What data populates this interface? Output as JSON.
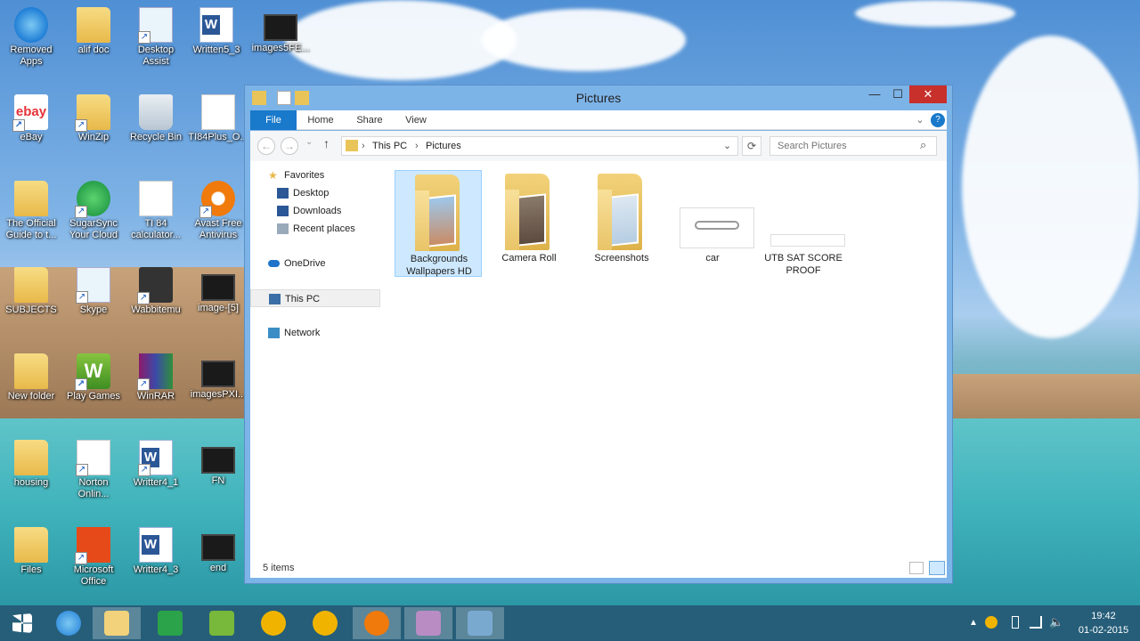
{
  "desktop": {
    "icons": [
      {
        "label": "Removed Apps"
      },
      {
        "label": "alif doc"
      },
      {
        "label": "Desktop Assist"
      },
      {
        "label": "Written5_3"
      },
      {
        "label": "images5FE..."
      },
      {
        "label": "eBay"
      },
      {
        "label": "WinZip"
      },
      {
        "label": "Recycle Bin"
      },
      {
        "label": "TI84Plus_O..."
      },
      {
        "label": "The Official Guide to t..."
      },
      {
        "label": "SugarSync Your Cloud"
      },
      {
        "label": "TI 84 calculator..."
      },
      {
        "label": "Avast Free Antivirus"
      },
      {
        "label": "SUBJECTS"
      },
      {
        "label": "Skype"
      },
      {
        "label": "Wabbitemu"
      },
      {
        "label": "image-[5]"
      },
      {
        "label": "New folder"
      },
      {
        "label": "Play Games"
      },
      {
        "label": "WinRAR"
      },
      {
        "label": "imagesPXI..."
      },
      {
        "label": "housing"
      },
      {
        "label": "Norton Onlin..."
      },
      {
        "label": "Writter4_1"
      },
      {
        "label": "FN"
      },
      {
        "label": "Files"
      },
      {
        "label": "Microsoft Office"
      },
      {
        "label": "Writter4_3"
      },
      {
        "label": "end"
      }
    ],
    "ebay_text": "ebay",
    "games_text": "W"
  },
  "window": {
    "title": "Pictures",
    "controls": {
      "minimize": "—",
      "maximize": "☐",
      "close": "✕"
    },
    "ribbon": {
      "file": "File",
      "home": "Home",
      "share": "Share",
      "view": "View",
      "help": "?"
    },
    "nav": {
      "back": "←",
      "forward": "→",
      "up": "↑",
      "refresh": "⟳",
      "dropdown": "⌄"
    },
    "address": {
      "crumb1": "This PC",
      "crumb2": "Pictures",
      "sep": "›"
    },
    "search": {
      "placeholder": "Search Pictures",
      "icon": "⌕"
    },
    "navpane": {
      "favorites": "Favorites",
      "desktop": "Desktop",
      "downloads": "Downloads",
      "recent": "Recent places",
      "onedrive": "OneDrive",
      "thispc": "This PC",
      "network": "Network"
    },
    "items": [
      {
        "name": "Backgrounds Wallpapers HD"
      },
      {
        "name": "Camera Roll"
      },
      {
        "name": "Screenshots"
      },
      {
        "name": "car"
      },
      {
        "name": "UTB SAT SCORE PROOF"
      }
    ],
    "status": "5 items"
  },
  "taskbar": {
    "time": "19:42",
    "date": "01-02-2015"
  }
}
